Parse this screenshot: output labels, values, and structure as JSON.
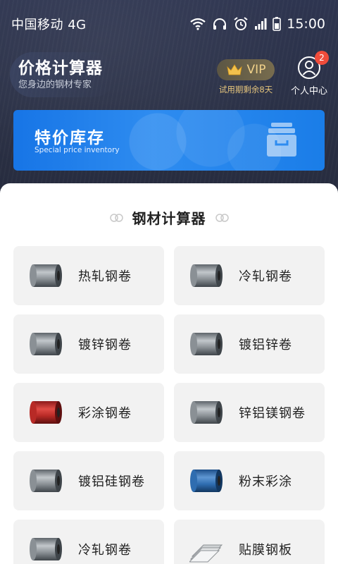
{
  "status_bar": {
    "carrier": "中国移动 4G",
    "time": "15:00",
    "icons": [
      "wifi-icon",
      "headphones-icon",
      "alarm-icon",
      "signal-icon",
      "battery-icon"
    ]
  },
  "header": {
    "title": "价格计算器",
    "subtitle": "您身边的钢材专家",
    "vip_label": "VIP",
    "vip_trial": "试用期剩余8天",
    "profile_label": "个人中心",
    "profile_badge": "2"
  },
  "banner": {
    "title": "特价库存",
    "subtitle": "Special price inventory"
  },
  "section": {
    "title": "钢材计算器"
  },
  "items": [
    {
      "label": "热轧钢卷",
      "coil": "steel"
    },
    {
      "label": "冷轧钢卷",
      "coil": "steel"
    },
    {
      "label": "镀锌钢卷",
      "coil": "steel"
    },
    {
      "label": "镀铝锌卷",
      "coil": "steel"
    },
    {
      "label": "彩涂钢卷",
      "coil": "red"
    },
    {
      "label": "锌铝镁钢卷",
      "coil": "steel"
    },
    {
      "label": "镀铝硅钢卷",
      "coil": "steel"
    },
    {
      "label": "粉末彩涂",
      "coil": "blue"
    },
    {
      "label": "冷轧钢卷",
      "coil": "steel"
    },
    {
      "label": "贴膜钢板",
      "coil": "sheet"
    }
  ],
  "colors": {
    "banner": "#1775e6",
    "vip_gold": "#e5c57c",
    "badge_red": "#f04c3b",
    "card_bg": "#f2f2f2"
  }
}
